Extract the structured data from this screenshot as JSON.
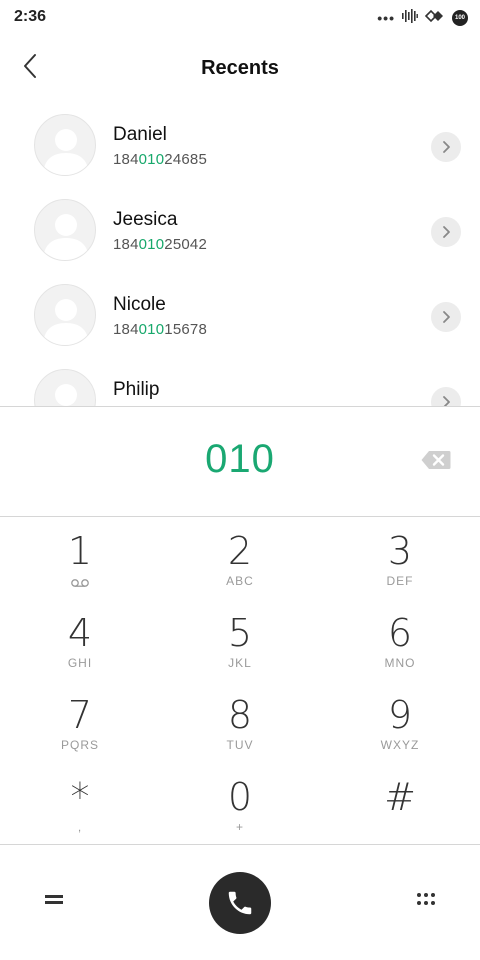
{
  "status_bar": {
    "time": "2:36",
    "dots": "•••",
    "battery": "100",
    "icons": [
      "more-dots-icon",
      "vibrate-signal-icon",
      "wifi-signal-icon",
      "battery-icon"
    ]
  },
  "header": {
    "title": "Recents",
    "back_icon": "back-chevron-icon"
  },
  "contacts": [
    {
      "name": "Daniel",
      "number_prefix": "184",
      "number_match": "010",
      "number_suffix": "24685"
    },
    {
      "name": "Jeesica",
      "number_prefix": "184",
      "number_match": "010",
      "number_suffix": "25042"
    },
    {
      "name": "Nicole",
      "number_prefix": "184",
      "number_match": "010",
      "number_suffix": "15678"
    },
    {
      "name": "Philip",
      "number_prefix": "",
      "number_match": "",
      "number_suffix": ""
    }
  ],
  "dialer": {
    "dialed_number": "010",
    "backspace_icon": "backspace-icon"
  },
  "keypad": [
    {
      "digit": "1",
      "letters": "",
      "sub_icon": "voicemail-icon"
    },
    {
      "digit": "2",
      "letters": "ABC"
    },
    {
      "digit": "3",
      "letters": "DEF"
    },
    {
      "digit": "4",
      "letters": "GHI"
    },
    {
      "digit": "5",
      "letters": "JKL"
    },
    {
      "digit": "6",
      "letters": "MNO"
    },
    {
      "digit": "7",
      "letters": "PQRS"
    },
    {
      "digit": "8",
      "letters": "TUV"
    },
    {
      "digit": "9",
      "letters": "WXYZ"
    },
    {
      "digit": "*",
      "letters": ","
    },
    {
      "digit": "0",
      "letters": "+"
    },
    {
      "digit": "#",
      "letters": ""
    }
  ],
  "bottom_bar": {
    "menu_icon": "menu-equals-icon",
    "call_icon": "phone-call-icon",
    "grid_icon": "dialpad-grid-icon"
  },
  "colors": {
    "accent_green": "#1aa872",
    "call_button": "#2a2a2a",
    "divider": "#d6d6d6"
  }
}
